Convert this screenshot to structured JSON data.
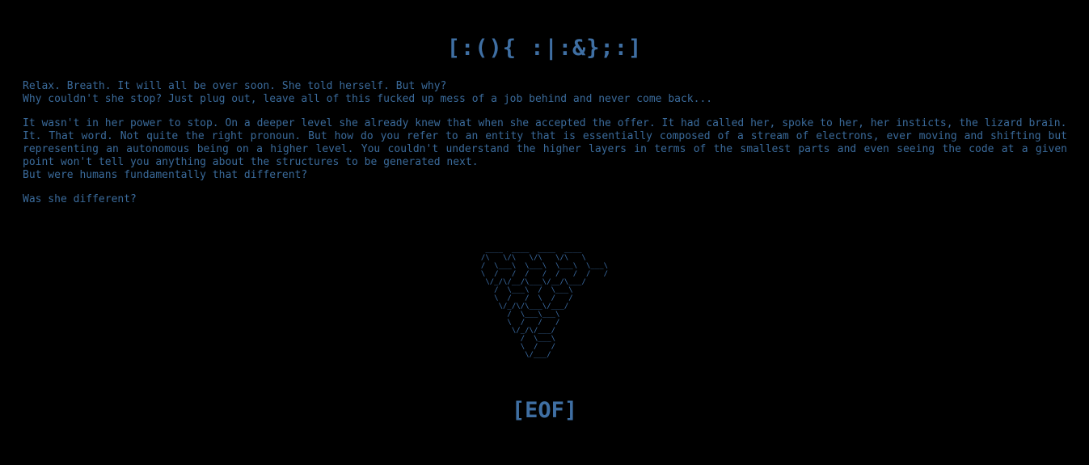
{
  "title": "[:(){ :|:&};:]",
  "story": {
    "p1_l1": "Relax. Breath. It will all be over soon. She told herself. But why?",
    "p1_l2": "Why couldn't she stop? Just plug out, leave all of this fucked up mess of a job behind and never come back...",
    "p2_l1": "It wasn't in her power to stop. On a deeper level she already knew that when she accepted the offer. It had called her, spoke to her, her insticts, the lizard brain.",
    "p2_l2": "It. That word. Not quite the right pronoun. But how do you refer to an entity that is essentially composed of a stream of electrons, ever moving and shifting but representing an autonomous being on a higher level. You couldn't understand the higher layers in terms of the smallest parts and even seeing the code at a given point won't tell you anything about the structures to be generated next.",
    "p2_l3": "But were humans fundamentally that different?",
    "p3_l1": "Was she different?"
  },
  "ascii_art": " ____  ____  ____  ____\n/\\   \\/\\   \\/\\   \\/\\   \\\n/  \\___\\  \\___\\  \\___\\  \\___\\\n\\  /   /  /   /  /   /  /   /\n \\/_/\\/__/\\___\\/__/\\___/\n   /  \\___\\  /  \\___\\\n   \\  /   /  \\  /   /\n    \\/_/\\/\\___\\/___/\n      /  \\___\\___\\\n      \\  /   /   /\n       \\/_/\\/___/\n         /  \\___\\\n         \\  /   /\n          \\/___/",
  "eof": "[EOF]"
}
